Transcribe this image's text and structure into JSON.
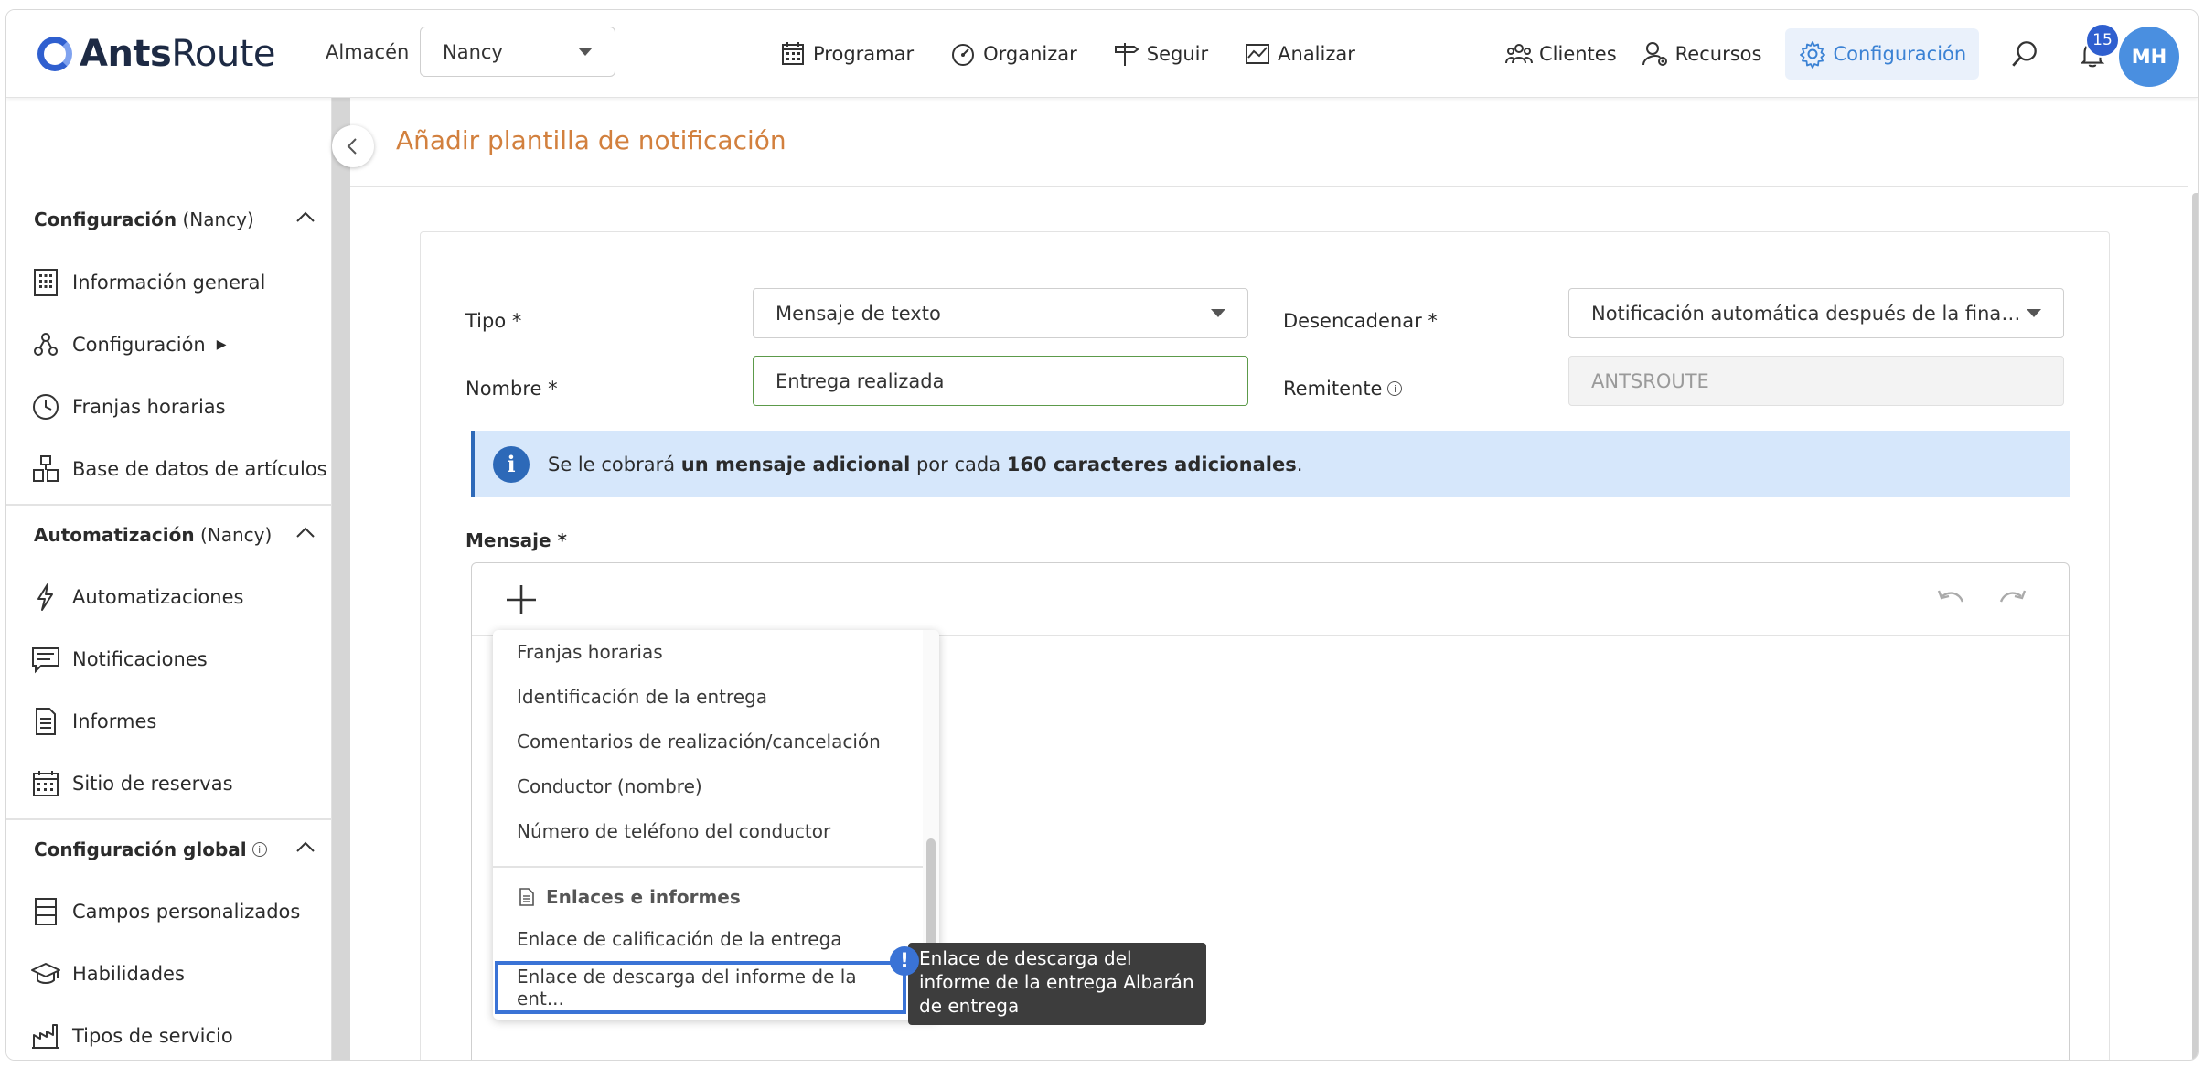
{
  "header": {
    "logo": {
      "bold": "Ants",
      "regular": "Route"
    },
    "warehouse_label": "Almacén",
    "warehouse_value": "Nancy",
    "nav_center": [
      {
        "label": "Programar",
        "icon": "calendar-icon"
      },
      {
        "label": "Organizar",
        "icon": "gauge-icon"
      },
      {
        "label": "Seguir",
        "icon": "signpost-icon"
      },
      {
        "label": "Analizar",
        "icon": "chart-icon"
      }
    ],
    "nav_right": [
      {
        "label": "Clientes",
        "icon": "clients-icon"
      },
      {
        "label": "Recursos",
        "icon": "resources-icon"
      },
      {
        "label": "Configuración",
        "icon": "gear-icon",
        "active": true
      }
    ],
    "notification_count": "15",
    "avatar_initials": "MH",
    "accent_color": "#3b82d4"
  },
  "sidebar": {
    "sections": [
      {
        "title": "Configuración",
        "suffix": " (Nancy)",
        "items": [
          {
            "label": "Información general",
            "icon": "building-icon"
          },
          {
            "label": "Configuración",
            "icon": "nodes-icon",
            "arrow": "▶"
          },
          {
            "label": "Franjas horarias",
            "icon": "clock-icon"
          },
          {
            "label": "Base de datos de artículos",
            "icon": "boxes-icon"
          }
        ]
      },
      {
        "title": "Automatización",
        "suffix": " (Nancy)",
        "items": [
          {
            "label": "Automatizaciones",
            "icon": "lightning-icon"
          },
          {
            "label": "Notificaciones",
            "icon": "message-icon"
          },
          {
            "label": "Informes",
            "icon": "document-icon"
          },
          {
            "label": "Sitio de reservas",
            "icon": "calendar-grid-icon"
          }
        ]
      },
      {
        "title": "Configuración global",
        "suffix": "",
        "items": [
          {
            "label": "Campos personalizados",
            "icon": "fields-icon"
          },
          {
            "label": "Habilidades",
            "icon": "graduation-icon"
          },
          {
            "label": "Tipos de servicio",
            "icon": "factory-icon"
          }
        ]
      }
    ]
  },
  "main": {
    "title": "Añadir plantilla de notificación",
    "title_color": "#d2803e",
    "form": {
      "tipo_label": "Tipo *",
      "tipo_value": "Mensaje de texto",
      "trigger_label": "Desencadenar *",
      "trigger_value": "Notificación automática después de la finaliza...",
      "nombre_label": "Nombre *",
      "nombre_value": "Entrega realizada",
      "remitente_label": "Remitente",
      "remitente_value": "ANTSROUTE"
    },
    "info": {
      "t1": "Se le cobrará ",
      "b1": "un mensaje adicional",
      "t2": " por cada ",
      "b2": "160 caracteres adicionales",
      "t3": "."
    },
    "message_label": "Mensaje *",
    "dropdown": {
      "items": [
        "Franjas horarias",
        "Identificación de la entrega",
        "Comentarios de realización/cancelación",
        "Conductor (nombre)",
        "Número de teléfono del conductor"
      ],
      "group_label": "Enlaces e informes",
      "group_items": [
        "Enlace de calificación de la entrega"
      ],
      "selected": "Enlace de descarga del informe de la ent..."
    },
    "tooltip": "Enlace de descarga del informe de la entrega Albarán de entrega"
  }
}
